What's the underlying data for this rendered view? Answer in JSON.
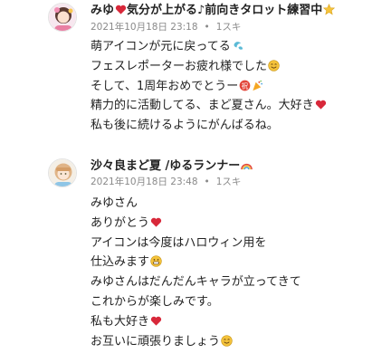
{
  "comments": [
    {
      "author": "みゆ",
      "author_suffix": "気分が上がる♪前向きタロット練習中",
      "date": "2021年10月18日 23:18",
      "likes": "1スキ",
      "lines": [
        "萌アイコンが元に戻ってる",
        "フェスレポーターお疲れ様でした",
        "そして、1周年おめでとうー",
        "精力的に活動してる、まど夏さん。大好き",
        "私も後に続けるようにがんばるね。"
      ]
    },
    {
      "author": "沙々良まど夏 /ゆるランナー",
      "date": "2021年10月18日 23:48",
      "likes": "1スキ",
      "lines": [
        "みゆさん",
        "ありがとう",
        "アイコンは今度はハロウィン用を",
        "仕込みます",
        "みゆさんはだんだんキャラが立ってきて",
        "これからが楽しみです。",
        "私も大好き",
        "お互いに頑張りましょう"
      ]
    }
  ],
  "colors": {
    "heart": "#d8283a",
    "meta": "#8a8a8a",
    "smile": "#f5c33b"
  }
}
